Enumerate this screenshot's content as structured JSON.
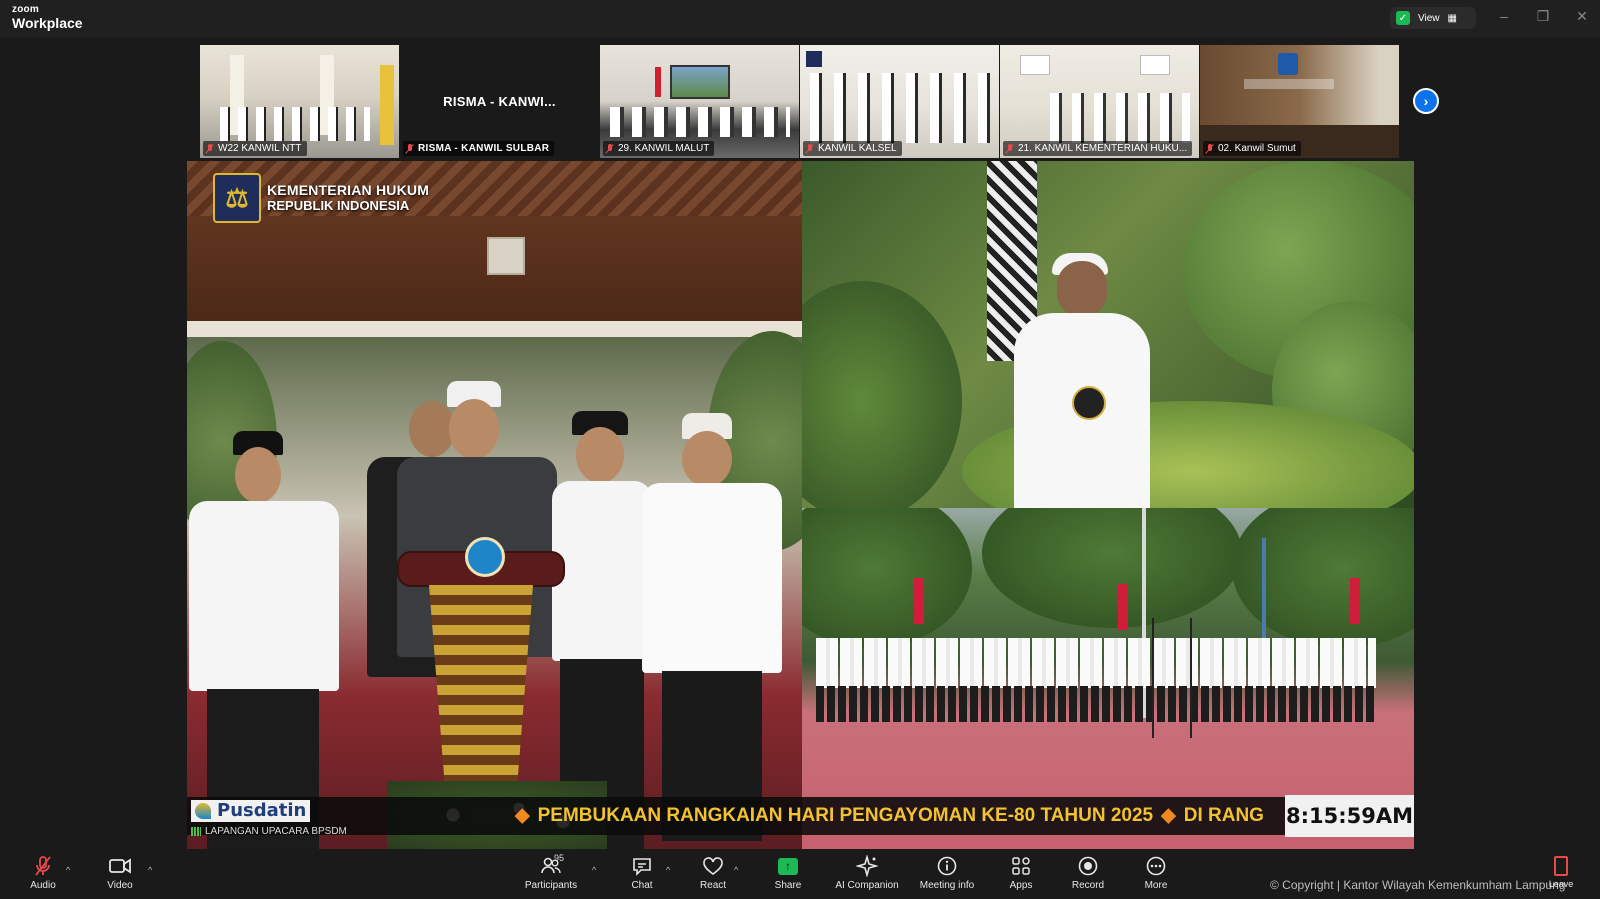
{
  "titlebar": {
    "brand_line1": "zoom",
    "brand_line2": "Workplace",
    "view_label": "View",
    "security_color": "#1db954"
  },
  "thumbnails": [
    {
      "label": "W22 KANWIL NTT",
      "muted": true
    },
    {
      "label": "RISMA - KANWIL SULBAR",
      "display_name": "RISMA - KANWI...",
      "muted": true,
      "video": false
    },
    {
      "label": "29. KANWIL MALUT",
      "muted": true
    },
    {
      "label": "KANWIL KALSEL",
      "muted": true
    },
    {
      "label": "21. KANWIL KEMENTERIAN HUKU...",
      "muted": true
    },
    {
      "label": "02. Kanwil Sumut",
      "muted": true
    }
  ],
  "share": {
    "org_line1": "KEMENTERIAN HUKUM",
    "org_line2": "REPUBLIK INDONESIA",
    "broadcaster": "Pusdatin",
    "location": "LAPANGAN UPACARA BPSDM",
    "ticker_text": "PEMBUKAAN RANGKAIAN HARI PENGAYOMAN KE-80 TAHUN 2025",
    "ticker_text2": "DI RANG",
    "clock": "8:15:59AM"
  },
  "toolbar": {
    "audio": "Audio",
    "video": "Video",
    "participants": "Participants",
    "participant_count": "95",
    "chat": "Chat",
    "react": "React",
    "share": "Share",
    "ai_companion": "AI Companion",
    "meeting_info": "Meeting info",
    "apps": "Apps",
    "record": "Record",
    "more": "More",
    "leave": "Leave",
    "accent_color": "#e84a4a"
  },
  "copyright": "© Copyright | Kantor Wilayah Kemenkumham Lampung"
}
